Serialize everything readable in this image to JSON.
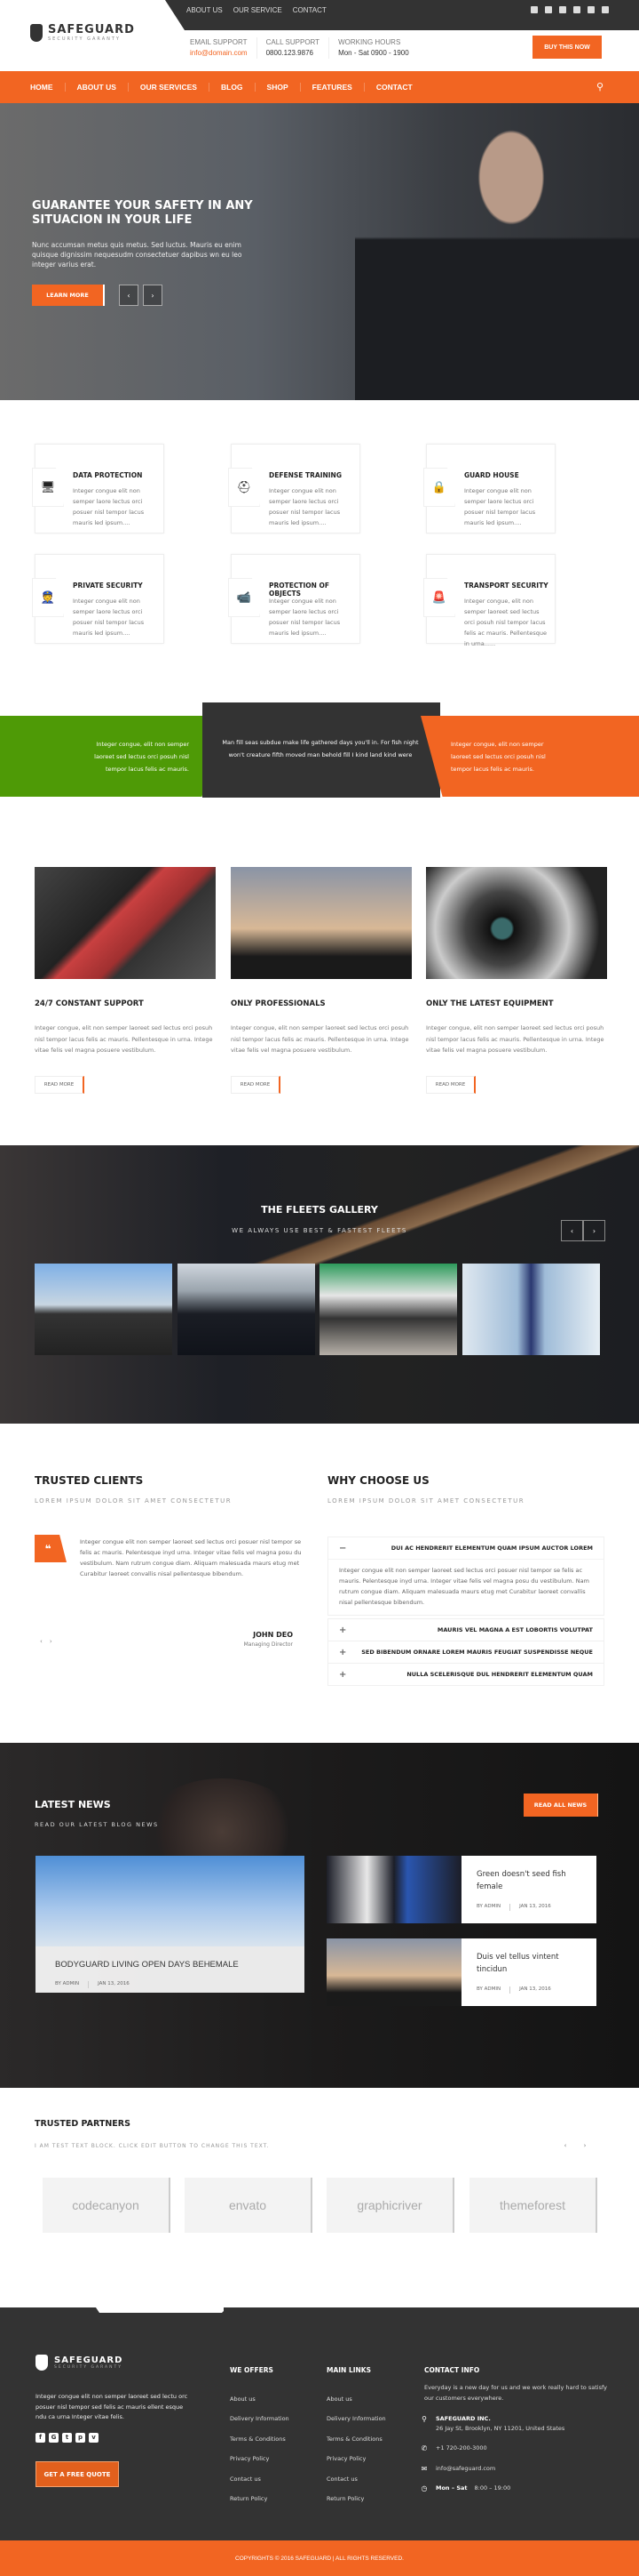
{
  "colors": {
    "accent": "#f26522",
    "dark": "#333333",
    "green": "#4e9a06"
  },
  "topbar": {
    "links": [
      "ABOUT US",
      "OUR SERVICE",
      "CONTACT"
    ],
    "social_icons": [
      "facebook-icon",
      "youtube-icon",
      "vimeo-icon",
      "twitter-icon",
      "google-plus-icon",
      "tumblr-icon"
    ]
  },
  "brand": {
    "name": "SAFEGUARD",
    "tagline": "SECURITY GARANTY"
  },
  "contact_bar": [
    {
      "label": "EMAIL SUPPORT",
      "value": "info@domain.com"
    },
    {
      "label": "CALL SUPPORT",
      "value": "0800.123.9876"
    },
    {
      "label": "WORKING HOURS",
      "value": "Mon - Sat 0900 - 1900"
    }
  ],
  "buy_button": "BUY THIS NOW",
  "nav": {
    "items": [
      "HOME",
      "ABOUT US",
      "OUR SERVICES",
      "BLOG",
      "SHOP",
      "FEATURES",
      "CONTACT"
    ],
    "search_icon": "search-icon"
  },
  "hero": {
    "title": "GUARANTEE YOUR SAFETY IN ANY SITUACION IN YOUR LIFE",
    "text": "Nunc accumsan metus quis metus. Sed luctus. Mauris eu enim quisque dignissim nequesudm consectetuer dapibus wn eu leo integer varius erat.",
    "button": "LEARN MORE",
    "prev": "‹",
    "next": "›"
  },
  "features": [
    {
      "title": "DATA PROTECTION",
      "icon": "monitor-icon",
      "glyph": "🖥",
      "text": "Integer congue elit non semper laore lectus orci posuer nisl tempor lacus mauris led ipsum...."
    },
    {
      "title": "DEFENSE TRAINING",
      "icon": "helmet-icon",
      "glyph": "⛑",
      "text": "Integer congue elit non semper laore lectus orci posuer nisl tempor lacus mauris led ipsum...."
    },
    {
      "title": "GUARD HOUSE",
      "icon": "lock-icon",
      "glyph": "🔒",
      "text": "Integer congue elit non semper laore lectus orci posuer nisl tempor lacus mauris led ipsum...."
    },
    {
      "title": "PRIVATE SECURITY",
      "icon": "guard-icon",
      "glyph": "👮",
      "text": "Integer congue elit non semper laore lectus orci posuer nisl tempor lacus mauris led ipsum...."
    },
    {
      "title": "PROTECTION OF OBJECTS",
      "icon": "camera-icon",
      "glyph": "📹",
      "text": "Integer congue elit non semper laore lectus orci posuer nisl tempor lacus mauris led ipsum...."
    },
    {
      "title": "TRANSPORT SECURITY",
      "icon": "siren-icon",
      "glyph": "🚨",
      "text": "Integer congue, elit non semper laoreet sed lectus orci posuh nisl tempor lacus felis ac mauris. Pellentesque in urna......"
    }
  ],
  "band": {
    "left": "Integer congue, elit non semper laoreet sed lectus orci posuh nisl tempor lacus felis ac mauris.",
    "center": "Man fill seas subdue make life gathered days you'll in. For fish night won't creature fifth moved man behold fill I kind land kind were",
    "right": "Integer congue, elit non semper laoreet sed lectus orci posuh nisl tempor lacus felis ac mauris."
  },
  "services": [
    {
      "title": "24/7 CONSTANT SUPPORT",
      "text": "Integer congue, elit non semper laoreet sed lectus orci posuh nisl tempor lacus felis ac mauris. Pellentesque in urna. Intege vitae felis vel magna posuere vestibulum.",
      "button": "READ MORE"
    },
    {
      "title": "ONLY PROFESSIONALS",
      "text": "Integer congue, elit non semper laoreet sed lectus orci posuh nisl tempor lacus felis ac mauris. Pellentesque in urna. Intege vitae felis vel magna posuere vestibulum.",
      "button": "READ MORE"
    },
    {
      "title": "ONLY THE LATEST EQUIPMENT",
      "text": "Integer congue, elit non semper laoreet sed lectus orci posuh nisl tempor lacus felis ac mauris. Pellentesque in urna. Intege vitae felis vel magna posuere vestibulum.",
      "button": "READ MORE"
    }
  ],
  "gallery": {
    "title": "THE FLEETS GALLERY",
    "subtitle": "WE ALWAYS USE BEST & FASTEST FLEETS",
    "prev": "‹",
    "next": "›"
  },
  "clients": {
    "title": "TRUSTED CLIENTS",
    "subtitle": "LOREM IPSUM DOLOR SIT AMET CONSECTETUR",
    "quote_mark": "❝",
    "text": "Integer congue elit non semper laoreet sed lectus orci posuer nisl tempor se felis ac mauris. Pelentesque inyd urna. Integer vitae felis vel magna posu du vestibulum. Nam rutrum congue diam. Aliquam malesuada maurs etug met Curabitur laoreet convallis nisal pellentesque bibendum.",
    "name": "JOHN DEO",
    "role": "Managing Director",
    "prev": "‹",
    "next": "›"
  },
  "why": {
    "title": "WHY CHOOSE US",
    "subtitle": "LOREM IPSUM DOLOR SIT AMET CONSECTETUR",
    "items": [
      {
        "title": "DUI AC HENDRERIT ELEMENTUM QUAM IPSUM AUCTOR LOREM",
        "sign": "−",
        "open": true,
        "body": "Integer congue elit non semper laoreet sed lectus orci posuer nisl tempor se felis ac mauris. Pelentesque inyd urna. Integer vitae felis vel magna posu du vestibulum. Nam rutrum congue diam. Aliquam malesuada maurs etug met Curabitur laoreet convallis nisal pellentesque bibendum."
      },
      {
        "title": "MAURIS VEL MAGNA A EST LOBORTIS VOLUTPAT",
        "sign": "+",
        "open": false
      },
      {
        "title": "SED BIBENDUM ORNARE LOREM MAURIS FEUGIAT SUSPENDISSE NEQUE",
        "sign": "+",
        "open": false
      },
      {
        "title": "NULLA SCELERISQUE DUL HENDRERIT ELEMENTUM QUAM",
        "sign": "+",
        "open": false
      }
    ]
  },
  "news": {
    "title": "LATEST NEWS",
    "subtitle": "READ OUR LATEST BLOG NEWS",
    "button": "READ ALL NEWS",
    "posts": [
      {
        "title": "BODYGUARD LIVING OPEN DAYS BEHEMALE",
        "author": "BY ADMIN",
        "date": "JAN 13, 2016"
      },
      {
        "title": "Green doesn't seed fish female",
        "author": "BY ADMIN",
        "date": "JAN 13, 2016"
      },
      {
        "title": "Duis vel tellus vintent tincidun",
        "author": "BY ADMIN",
        "date": "JAN 13, 2016"
      }
    ]
  },
  "partners": {
    "title": "TRUSTED PARTNERS",
    "subtitle": "I AM TEST TEXT BLOCK. CLICK EDIT BUTTON TO CHANGE THIS TEXT.",
    "prev": "‹",
    "next": "›",
    "logos": [
      "codecanyon",
      "envato",
      "graphicriver",
      "themeforest"
    ]
  },
  "footer": {
    "about": "Integer congue elit non semper laoreet sed lectu orc posuer nisl tempor sed felis ac mauris ellent esque ndu ca urna Integer vitae felis.",
    "social": [
      {
        "icon": "facebook-icon",
        "glyph": "f"
      },
      {
        "icon": "google-plus-icon",
        "glyph": "G"
      },
      {
        "icon": "twitter-icon",
        "glyph": "t"
      },
      {
        "icon": "pinterest-icon",
        "glyph": "p"
      },
      {
        "icon": "vimeo-icon",
        "glyph": "v"
      }
    ],
    "quote_button": "GET A FREE QUOTE",
    "offers_title": "WE OFFERS",
    "offers": [
      "About us",
      "Delivery Information",
      "Terms & Conditions",
      "Privacy Policy",
      "Contact us",
      "Return Policy"
    ],
    "links_title": "MAIN LINKS",
    "links": [
      "About us",
      "Delivery Information",
      "Terms & Conditions",
      "Privacy Policy",
      "Contact us",
      "Return Policy"
    ],
    "contact_title": "CONTACT INFO",
    "contact_text": "Everyday is a new day for us and we work really hard to satisfy our customers everywhere.",
    "company": "SAFEGUARD INC.",
    "address": "26 Jay St, Brooklyn, NY 11201, United States",
    "phone": "+1 720-200-3000",
    "email": "info@safeguard.com",
    "hours_days": "Mon – Sat",
    "hours_time": "8:00 – 19:00",
    "copyright": "COPYRIGHTS © 2016 SAFEGUARD | ALL RIGHTS RESERVED."
  }
}
